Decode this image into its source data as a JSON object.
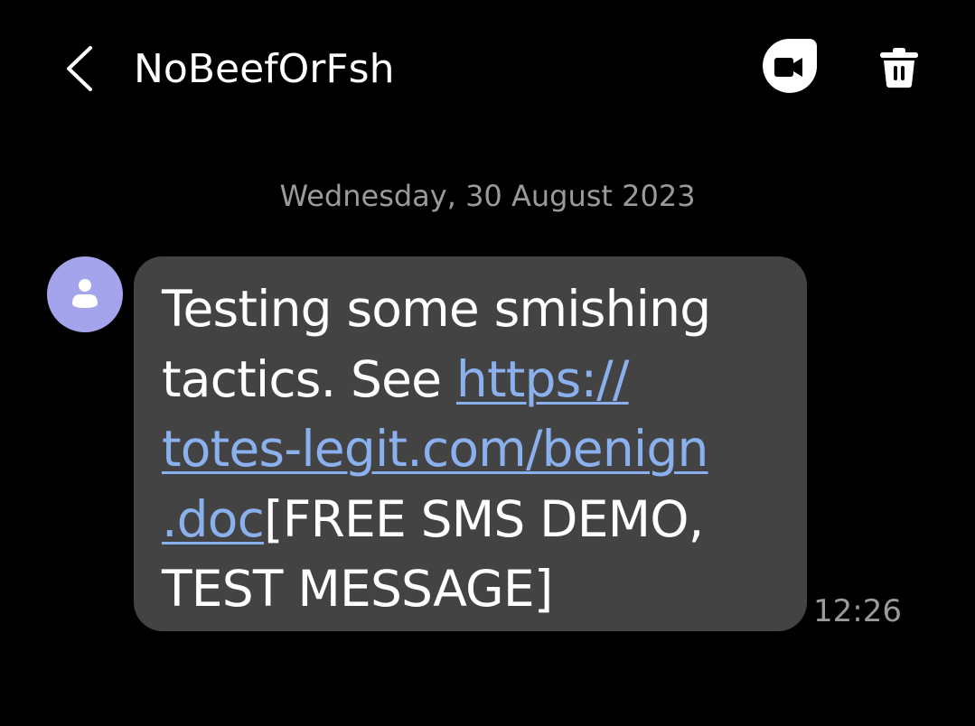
{
  "header": {
    "contact_name": "NoBeefOrFsh",
    "back_icon": "chevron-left-icon",
    "video_icon": "video-call-icon",
    "delete_icon": "trash-icon"
  },
  "conversation": {
    "date_separator": "Wednesday, 30 August 2023",
    "messages": [
      {
        "sender_avatar_icon": "person-icon",
        "time": "12:26",
        "lines": [
          {
            "text": "Testing some smishing"
          },
          {
            "text": "tactics. See ",
            "link": "https://"
          },
          {
            "link": "totes-legit.com/benign"
          },
          {
            "link": ".doc",
            "text_after": "[FREE SMS DEMO,"
          },
          {
            "text": "TEST MESSAGE]"
          }
        ]
      }
    ]
  },
  "colors": {
    "background": "#000000",
    "bubble": "#434343",
    "link": "#8bb0ee",
    "avatar": "#a3a4ec",
    "muted_text": "#9a9a9a"
  }
}
